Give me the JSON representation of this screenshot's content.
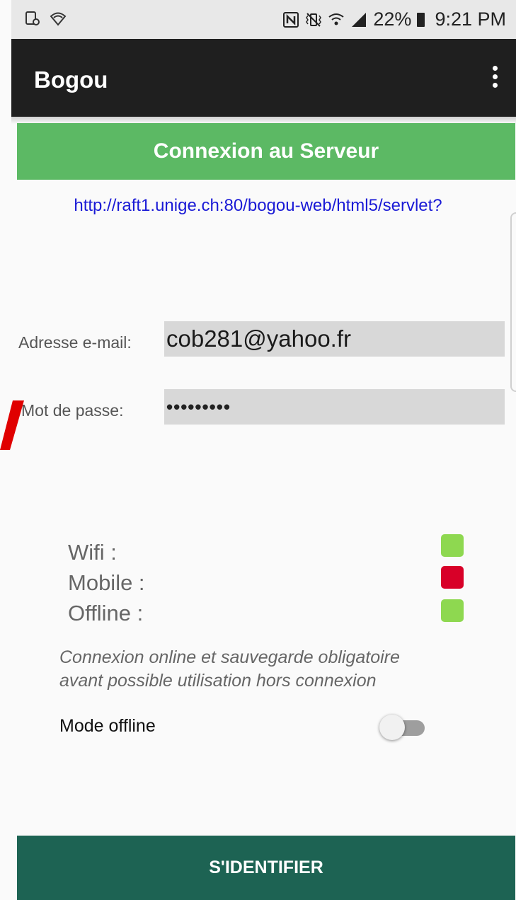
{
  "status_bar": {
    "left_icons": [
      "screenshot-icon",
      "wifi-outline-icon"
    ],
    "right_icons": [
      "nfc-icon",
      "vibrate-icon",
      "wifi-calling-icon",
      "signal-icon"
    ],
    "battery": "22%",
    "time": "9:21 PM"
  },
  "app_bar": {
    "title": "Bogou",
    "overflow_icon": "more-vert-icon"
  },
  "banner": {
    "title": "Connexion au Serveur",
    "color": "#5cb964"
  },
  "server": {
    "url": "http://raft1.unige.ch:80/bogou-web/html5/servlet?"
  },
  "form": {
    "email_label": "Adresse e-mail:",
    "email_value": "cob281@yahoo.fr",
    "password_label": "Mot de passe:",
    "password_value": "•••••••••"
  },
  "connection": {
    "wifi_label": "Wifi :",
    "mobile_label": "Mobile :",
    "offline_label": "Offline :",
    "wifi_status": "on",
    "mobile_status": "off",
    "offline_status": "on",
    "color_on": "#8ed850",
    "color_off": "#d80028"
  },
  "note": {
    "line1": "Connexion online et sauvegarde obligatoire",
    "line2": "avant possible utilisation hors connexion"
  },
  "mode_offline": {
    "label": "Mode offline",
    "enabled": false
  },
  "submit_button": {
    "label": "S'IDENTIFIER",
    "color": "#1d6353"
  },
  "annotation": {
    "arrow_color": "#e00000"
  }
}
